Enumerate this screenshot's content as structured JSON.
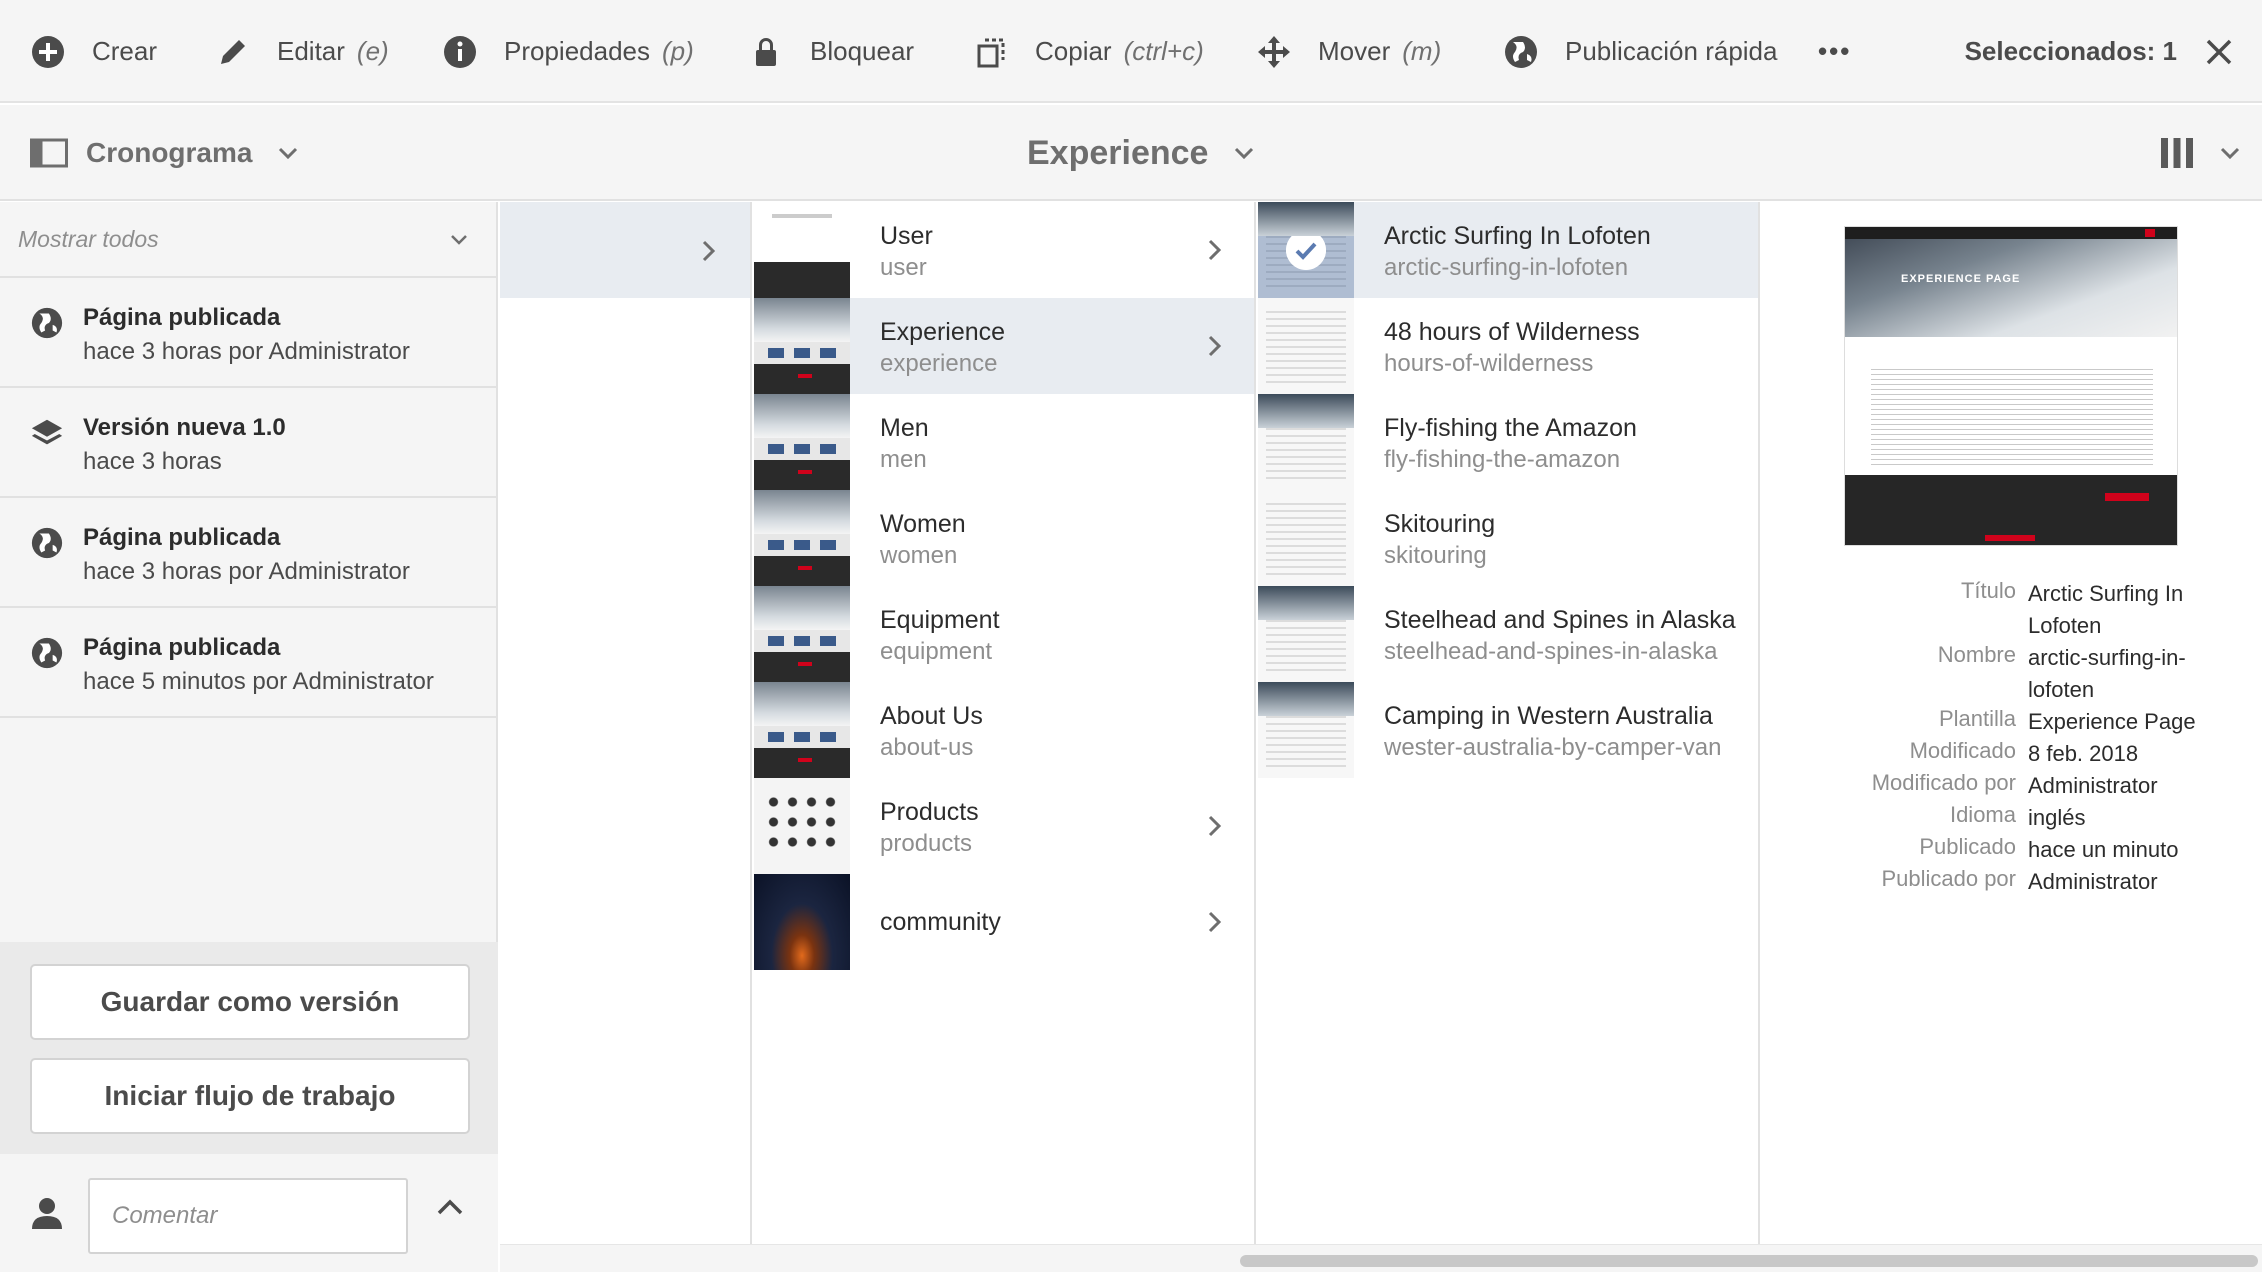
{
  "toolbar": {
    "create_label": "Crear",
    "edit_label": "Editar",
    "edit_shortcut": "(e)",
    "properties_label": "Propiedades",
    "properties_shortcut": "(p)",
    "lock_label": "Bloquear",
    "copy_label": "Copiar",
    "copy_shortcut": "(ctrl+c)",
    "move_label": "Mover",
    "move_shortcut": "(m)",
    "quick_publish_label": "Publicación rápida",
    "more_label": "•••",
    "selected_label": "Seleccionados: 1",
    "icons": [
      "add-circle-icon",
      "pencil-icon",
      "info-icon",
      "lock-icon",
      "copy-icon",
      "move-icon",
      "globe-icon",
      "more-icon",
      "close-icon"
    ]
  },
  "header": {
    "rail_label": "Cronograma",
    "breadcrumb": "Experience"
  },
  "timeline": {
    "filter": "Mostrar todos",
    "events": [
      {
        "title": "Página publicada",
        "subtitle": "hace 3 horas por Administrator",
        "icon": "globe-icon"
      },
      {
        "title": "Versión nueva 1.0",
        "subtitle": "hace 3 horas",
        "icon": "layers-icon"
      },
      {
        "title": "Página publicada",
        "subtitle": "hace 3 horas por Administrator",
        "icon": "globe-icon"
      },
      {
        "title": "Página publicada",
        "subtitle": "hace 5 minutos por Administrator",
        "icon": "globe-icon"
      }
    ],
    "save_version": "Guardar como versión",
    "start_workflow": "Iniciar flujo de trabajo",
    "comment_placeholder": "Comentar"
  },
  "column1": [
    {
      "title": "User",
      "name": "user",
      "has_children": true
    },
    {
      "title": "Experience",
      "name": "experience",
      "has_children": true,
      "active": true
    },
    {
      "title": "Men",
      "name": "men",
      "has_children": false
    },
    {
      "title": "Women",
      "name": "women",
      "has_children": false
    },
    {
      "title": "Equipment",
      "name": "equipment",
      "has_children": false
    },
    {
      "title": "About Us",
      "name": "about-us",
      "has_children": false
    },
    {
      "title": "Products",
      "name": "products",
      "has_children": true
    },
    {
      "title": "community",
      "name": "",
      "has_children": true
    }
  ],
  "column2": [
    {
      "title": "Arctic Surfing In Lofoten",
      "name": "arctic-surfing-in-lofoten",
      "selected": true
    },
    {
      "title": "48 hours of Wilderness",
      "name": "hours-of-wilderness"
    },
    {
      "title": "Fly-fishing the Amazon",
      "name": "fly-fishing-the-amazon"
    },
    {
      "title": "Skitouring",
      "name": "skitouring"
    },
    {
      "title": "Steelhead and Spines in Alaska",
      "name": "steelhead-and-spines-in-alaska"
    },
    {
      "title": "Camping in Western Australia",
      "name": "wester-australia-by-camper-van"
    }
  ],
  "preview": {
    "image_heading": "EXPERIENCE PAGE",
    "meta": [
      {
        "key": "Título",
        "value": "Arctic Surfing In Lofoten"
      },
      {
        "key": "Nombre",
        "value": "arctic-surfing-in-lofoten"
      },
      {
        "key": "Plantilla",
        "value": "Experience Page"
      },
      {
        "key": "Modificado",
        "value": "8 feb. 2018"
      },
      {
        "key": "Modificado por",
        "value": "Administrator"
      },
      {
        "key": "Idioma",
        "value": "inglés"
      },
      {
        "key": "Publicado",
        "value": "hace un minuto"
      },
      {
        "key": "Publicado por",
        "value": "Administrator"
      }
    ]
  },
  "colors": {
    "accent": "#2680eb",
    "selected_bg": "#e8ecf1",
    "panel_bg": "#f5f5f5"
  }
}
